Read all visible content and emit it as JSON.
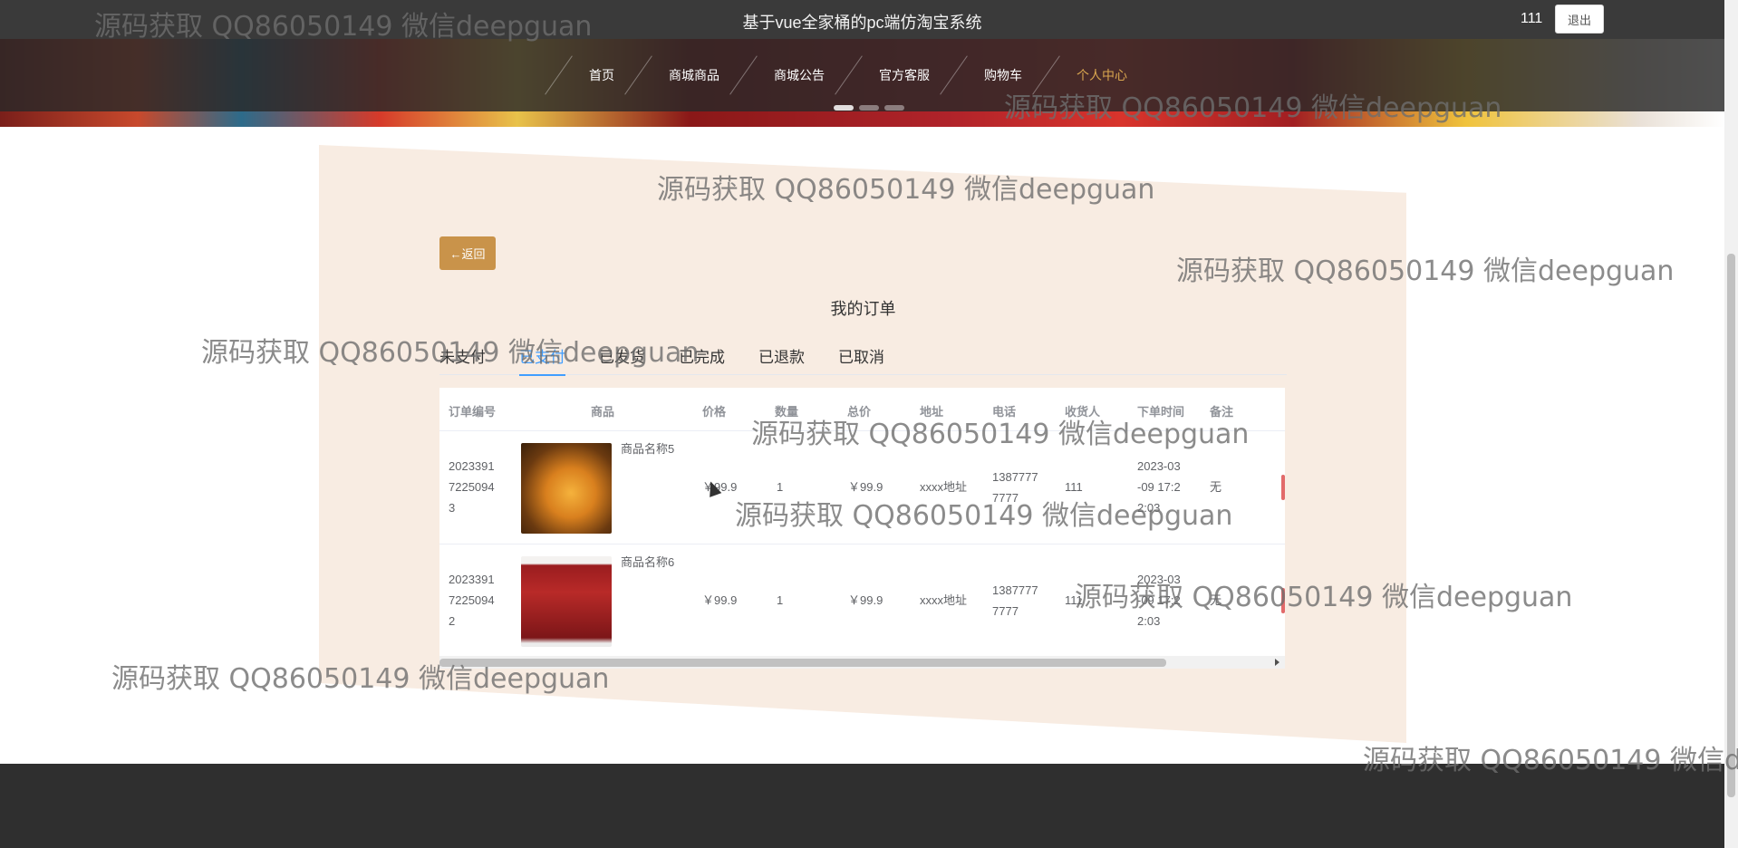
{
  "header": {
    "site_title": "基于vue全家桶的pc端仿淘宝系统",
    "username": "111",
    "logout_label": "退出"
  },
  "nav": {
    "items": [
      {
        "label": "首页"
      },
      {
        "label": "商城商品"
      },
      {
        "label": "商城公告"
      },
      {
        "label": "官方客服"
      },
      {
        "label": "购物车"
      },
      {
        "label": "个人中心"
      }
    ]
  },
  "page": {
    "back_label": "←返回",
    "title": "我的订单"
  },
  "tabs": [
    {
      "label": "未支付"
    },
    {
      "label": "已支付"
    },
    {
      "label": "已发货"
    },
    {
      "label": "已完成"
    },
    {
      "label": "已退款"
    },
    {
      "label": "已取消"
    }
  ],
  "table": {
    "headers": [
      "订单编号",
      "商品",
      "价格",
      "数量",
      "总价",
      "地址",
      "电话",
      "收货人",
      "下单时间",
      "备注"
    ],
    "rows": [
      {
        "order_no_1": "2023391",
        "order_no_2": "7225094",
        "order_no_3": "3",
        "product_name": "商品名称5",
        "image_icon": "lamp-image",
        "price": "￥99.9",
        "qty": "1",
        "total": "￥99.9",
        "address": "xxxx地址",
        "phone_1": "1387777",
        "phone_2": "7777",
        "receiver": "111",
        "time_1": "2023-03",
        "time_2": "-09 17:2",
        "time_3": "2:03",
        "remark": "无"
      },
      {
        "order_no_1": "2023391",
        "order_no_2": "7225094",
        "order_no_3": "2",
        "product_name": "商品名称6",
        "image_icon": "books-image",
        "price": "￥99.9",
        "qty": "1",
        "total": "￥99.9",
        "address": "xxxx地址",
        "phone_1": "1387777",
        "phone_2": "7777",
        "receiver": "111",
        "time_1": "2023-03",
        "time_2": "-09 17:2",
        "time_3": "2:03",
        "remark": "无"
      }
    ]
  },
  "watermark_text": "源码获取 QQ86050149 微信deepguan",
  "colors": {
    "accent": "#c9934a",
    "active_tab": "#409eff",
    "nav_active": "#d9a64f",
    "topbar": "#3a3a3a"
  }
}
